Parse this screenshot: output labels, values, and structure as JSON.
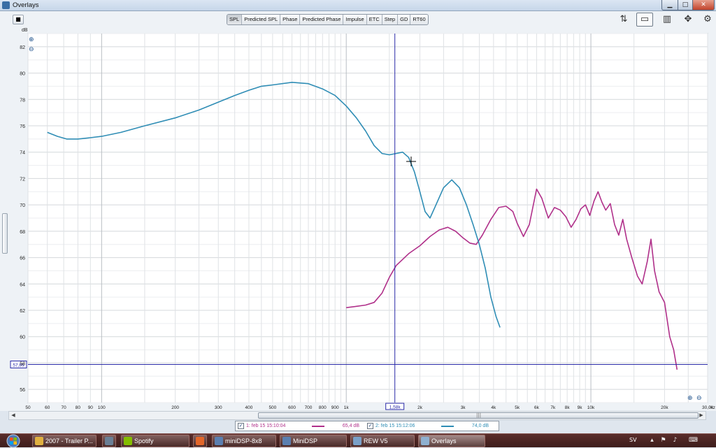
{
  "window": {
    "title": "Overlays"
  },
  "toolbar": {
    "tabs": [
      "SPL",
      "Predicted SPL",
      "Phase",
      "Predicted Phase",
      "Impulse",
      "ETC",
      "Step",
      "GD",
      "RT60"
    ],
    "active_tab": "SPL"
  },
  "legend": [
    {
      "checked": true,
      "label": "1: feb 15 15:10:04",
      "value": "65,4 dB",
      "color": "#b0308a"
    },
    {
      "checked": true,
      "label": "2: feb 15 15:12:06",
      "value": "74,0 dB",
      "color": "#2f8db5"
    }
  ],
  "cursor": {
    "x_readout": "1,58k",
    "y_readout": "57,89",
    "freq": 1580,
    "level": 57.89
  },
  "taskbar": {
    "tasks": [
      "2007 - Trailer P...",
      "",
      "Spotify",
      "",
      "miniDSP-8x8",
      "MiniDSP",
      "REW V5",
      "Overlays"
    ],
    "language": "SV"
  },
  "chart_data": {
    "type": "line",
    "xscale": "log",
    "xlim": [
      50,
      30000
    ],
    "ylim": [
      55,
      83
    ],
    "ylabel": "dB",
    "xunit": "Hz",
    "yticks": [
      56,
      58,
      60,
      62,
      64,
      66,
      68,
      70,
      72,
      74,
      76,
      78,
      80,
      82
    ],
    "xticks": [
      {
        "v": 50,
        "l": "50"
      },
      {
        "v": 60,
        "l": "60"
      },
      {
        "v": 70,
        "l": "70"
      },
      {
        "v": 80,
        "l": "80"
      },
      {
        "v": 90,
        "l": "90"
      },
      {
        "v": 100,
        "l": "100"
      },
      {
        "v": 200,
        "l": "200"
      },
      {
        "v": 300,
        "l": "300"
      },
      {
        "v": 400,
        "l": "400"
      },
      {
        "v": 500,
        "l": "500"
      },
      {
        "v": 600,
        "l": "600"
      },
      {
        "v": 700,
        "l": "700"
      },
      {
        "v": 800,
        "l": "800"
      },
      {
        "v": 900,
        "l": "900"
      },
      {
        "v": 1000,
        "l": "1k"
      },
      {
        "v": 2000,
        "l": "2k"
      },
      {
        "v": 3000,
        "l": "3k"
      },
      {
        "v": 4000,
        "l": "4k"
      },
      {
        "v": 5000,
        "l": "5k"
      },
      {
        "v": 6000,
        "l": "6k"
      },
      {
        "v": 7000,
        "l": "7k"
      },
      {
        "v": 8000,
        "l": "8k"
      },
      {
        "v": 9000,
        "l": "9k"
      },
      {
        "v": 10000,
        "l": "10k"
      },
      {
        "v": 20000,
        "l": "20k"
      },
      {
        "v": 30000,
        "l": "30,0k"
      }
    ],
    "series": [
      {
        "name": "1: feb 15 15:10:04",
        "color": "#b0308a",
        "points": [
          [
            1000,
            62.2
          ],
          [
            1100,
            62.3
          ],
          [
            1200,
            62.4
          ],
          [
            1300,
            62.6
          ],
          [
            1400,
            63.3
          ],
          [
            1500,
            64.5
          ],
          [
            1600,
            65.4
          ],
          [
            1800,
            66.3
          ],
          [
            2000,
            66.9
          ],
          [
            2200,
            67.6
          ],
          [
            2400,
            68.1
          ],
          [
            2600,
            68.3
          ],
          [
            2800,
            68.0
          ],
          [
            3000,
            67.5
          ],
          [
            3200,
            67.1
          ],
          [
            3400,
            67.0
          ],
          [
            3600,
            67.7
          ],
          [
            3900,
            68.9
          ],
          [
            4200,
            69.8
          ],
          [
            4500,
            69.9
          ],
          [
            4800,
            69.5
          ],
          [
            5000,
            68.6
          ],
          [
            5300,
            67.6
          ],
          [
            5600,
            68.5
          ],
          [
            6000,
            71.2
          ],
          [
            6300,
            70.5
          ],
          [
            6700,
            69.0
          ],
          [
            7100,
            69.8
          ],
          [
            7500,
            69.6
          ],
          [
            7900,
            69.1
          ],
          [
            8300,
            68.3
          ],
          [
            8700,
            68.9
          ],
          [
            9100,
            69.7
          ],
          [
            9500,
            70.0
          ],
          [
            9900,
            69.2
          ],
          [
            10300,
            70.3
          ],
          [
            10700,
            71.0
          ],
          [
            11100,
            70.2
          ],
          [
            11500,
            69.6
          ],
          [
            12000,
            70.1
          ],
          [
            12500,
            68.5
          ],
          [
            13000,
            67.7
          ],
          [
            13500,
            68.9
          ],
          [
            14000,
            67.4
          ],
          [
            14700,
            66.0
          ],
          [
            15500,
            64.6
          ],
          [
            16200,
            64.0
          ],
          [
            17000,
            65.7
          ],
          [
            17600,
            67.4
          ],
          [
            18200,
            65.0
          ],
          [
            19000,
            63.4
          ],
          [
            20000,
            62.6
          ],
          [
            21000,
            60.0
          ],
          [
            21800,
            59.0
          ],
          [
            22500,
            57.5
          ]
        ]
      },
      {
        "name": "2: feb 15 15:12:06",
        "color": "#2f8db5",
        "points": [
          [
            60,
            75.5
          ],
          [
            66,
            75.2
          ],
          [
            72,
            75.0
          ],
          [
            80,
            75.0
          ],
          [
            90,
            75.1
          ],
          [
            100,
            75.2
          ],
          [
            120,
            75.5
          ],
          [
            150,
            76.0
          ],
          [
            200,
            76.6
          ],
          [
            250,
            77.2
          ],
          [
            300,
            77.8
          ],
          [
            350,
            78.3
          ],
          [
            400,
            78.7
          ],
          [
            450,
            79.0
          ],
          [
            500,
            79.1
          ],
          [
            600,
            79.3
          ],
          [
            700,
            79.2
          ],
          [
            800,
            78.8
          ],
          [
            900,
            78.3
          ],
          [
            1000,
            77.5
          ],
          [
            1100,
            76.6
          ],
          [
            1200,
            75.6
          ],
          [
            1300,
            74.5
          ],
          [
            1400,
            73.9
          ],
          [
            1500,
            73.8
          ],
          [
            1600,
            73.9
          ],
          [
            1700,
            74.0
          ],
          [
            1800,
            73.6
          ],
          [
            1900,
            72.5
          ],
          [
            2000,
            71.0
          ],
          [
            2100,
            69.5
          ],
          [
            2200,
            69.0
          ],
          [
            2300,
            69.8
          ],
          [
            2500,
            71.3
          ],
          [
            2700,
            71.9
          ],
          [
            2900,
            71.3
          ],
          [
            3100,
            70.0
          ],
          [
            3300,
            68.5
          ],
          [
            3500,
            67.0
          ],
          [
            3700,
            65.2
          ],
          [
            3900,
            63.0
          ],
          [
            4100,
            61.5
          ],
          [
            4250,
            60.7
          ]
        ]
      }
    ]
  }
}
